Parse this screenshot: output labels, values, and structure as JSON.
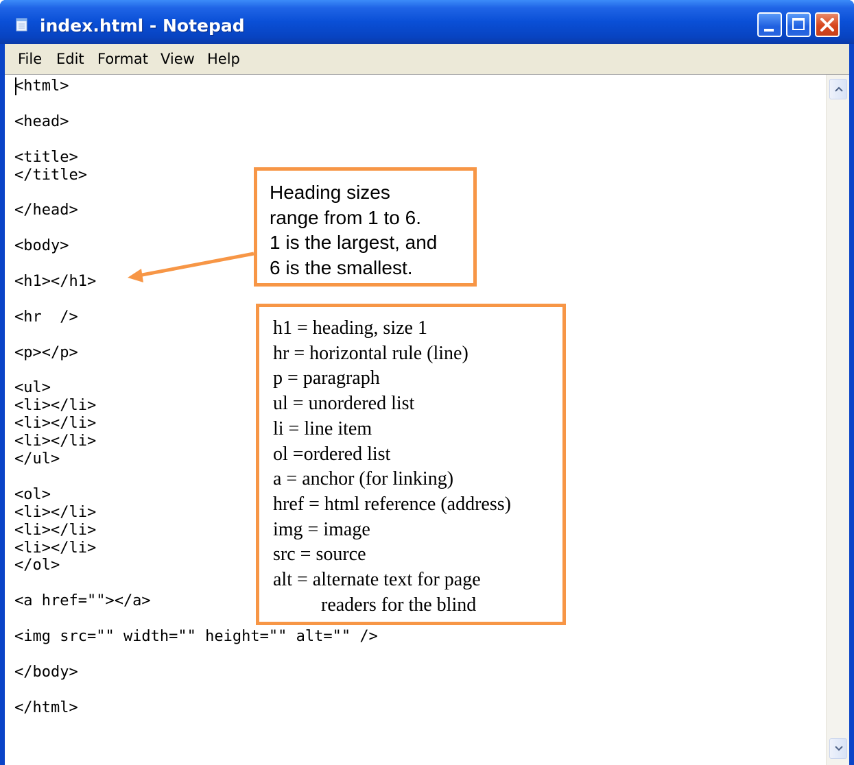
{
  "window": {
    "title": "index.html - Notepad",
    "icon": "notepad-icon",
    "buttons": [
      "minimize-icon",
      "maximize-icon",
      "close-icon"
    ]
  },
  "menu": {
    "items": [
      "File",
      "Edit",
      "Format",
      "View",
      "Help"
    ]
  },
  "editor": {
    "content": "<html>\n\n<head>\n\n<title>\n</title>\n\n</head>\n\n<body>\n\n<h1></h1>\n\n<hr  />\n\n<p></p>\n\n<ul>\n<li></li>\n<li></li>\n<li></li>\n</ul>\n\n<ol>\n<li></li>\n<li></li>\n<li></li>\n</ol>\n\n<a href=\"\"></a>\n\n<img src=\"\" width=\"\" height=\"\" alt=\"\" />\n\n</body>\n\n</html>"
  },
  "callouts": {
    "heading_note": [
      "Heading sizes",
      "range from 1 to 6.",
      "1 is the largest, and",
      "6 is the smallest."
    ],
    "tag_glossary": [
      "h1 = heading, size 1",
      "hr = horizontal rule (line)",
      "p = paragraph",
      "ul = unordered list",
      "li = line item",
      "ol =ordered list",
      "a = anchor (for linking)",
      "href = html reference (address)",
      "img = image",
      "src = source",
      "alt = alternate text for page",
      "readers for the blind"
    ]
  },
  "colors": {
    "callout_border": "#f79646",
    "titlebar": "#0a4fd6",
    "menubar": "#ece9d8"
  }
}
